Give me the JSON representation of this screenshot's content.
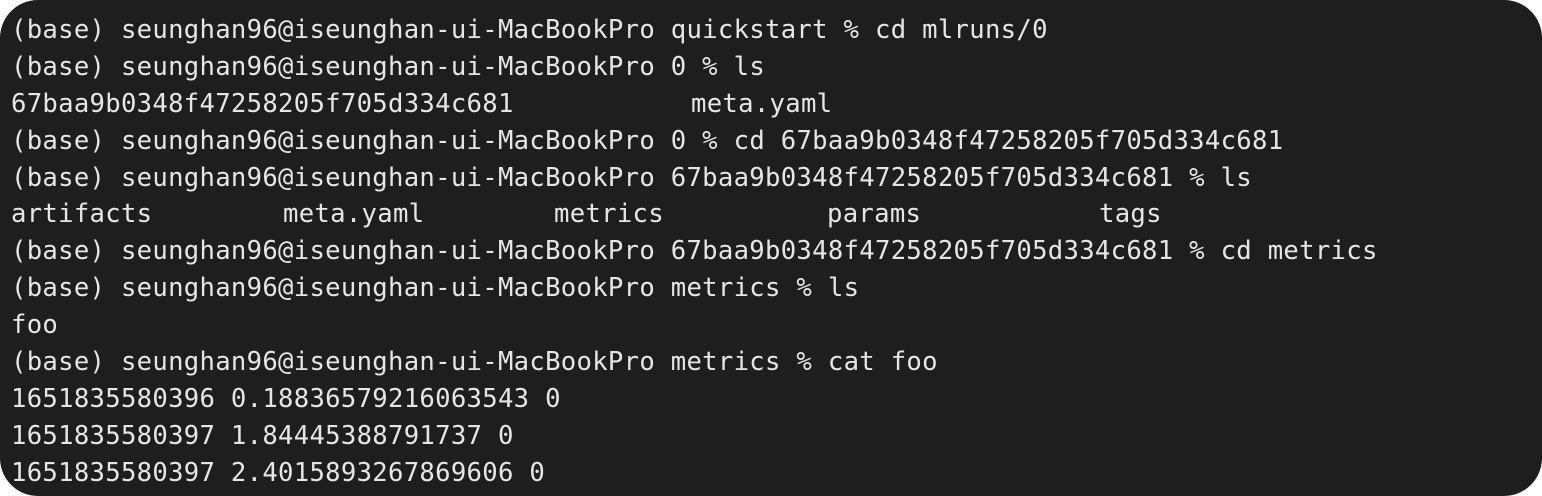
{
  "terminal": {
    "lines": [
      {
        "kind": "command",
        "prompt": "(base) seunghan96@iseunghan-ui-MacBookPro quickstart % ",
        "command": "cd mlruns/0"
      },
      {
        "kind": "command",
        "prompt": "(base) seunghan96@iseunghan-ui-MacBookPro 0 % ",
        "command": "ls"
      },
      {
        "kind": "output-cols",
        "cols": [
          "67baa9b0348f47258205f705d334c681",
          "meta.yaml"
        ]
      },
      {
        "kind": "command",
        "prompt": "(base) seunghan96@iseunghan-ui-MacBookPro 0 % ",
        "command": "cd 67baa9b0348f47258205f705d334c681"
      },
      {
        "kind": "command",
        "prompt": "(base) seunghan96@iseunghan-ui-MacBookPro 67baa9b0348f47258205f705d334c681 % ",
        "command": "ls"
      },
      {
        "kind": "output-cols",
        "cols": [
          "artifacts",
          "meta.yaml",
          "metrics",
          "params",
          "tags"
        ]
      },
      {
        "kind": "command",
        "prompt": "(base) seunghan96@iseunghan-ui-MacBookPro 67baa9b0348f47258205f705d334c681 % ",
        "command": "cd metrics"
      },
      {
        "kind": "command",
        "prompt": "(base) seunghan96@iseunghan-ui-MacBookPro metrics % ",
        "command": "ls"
      },
      {
        "kind": "output",
        "text": "foo"
      },
      {
        "kind": "command",
        "prompt": "(base) seunghan96@iseunghan-ui-MacBookPro metrics % ",
        "command": "cat foo"
      },
      {
        "kind": "output",
        "text": "1651835580396 0.18836579216063543 0"
      },
      {
        "kind": "output",
        "text": "1651835580397 1.84445388791737 0"
      },
      {
        "kind": "output",
        "text": "1651835580397 2.4015893267869606 0"
      }
    ]
  }
}
